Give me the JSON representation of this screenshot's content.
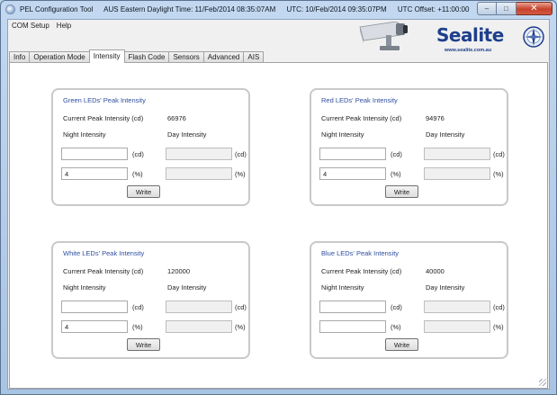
{
  "window": {
    "title_segments": [
      "PEL Configuration Tool",
      "AUS Eastern Daylight Time: 11/Feb/2014 08:35:07AM",
      "UTC: 10/Feb/2014 09:35:07PM",
      "UTC Offset: +11:00:00"
    ],
    "min_glyph": "–",
    "max_glyph": "□",
    "close_glyph": "✕"
  },
  "menu": {
    "items": [
      "COM Setup",
      "Help"
    ]
  },
  "logo": {
    "word": "Sealite",
    "url": "www.sealite.com.au"
  },
  "tabs": [
    "Info",
    "Operation Mode",
    "Intensity",
    "Flash Code",
    "Sensors",
    "Advanced",
    "AIS"
  ],
  "active_tab": "Intensity",
  "labels": {
    "current_peak": "Current Peak Intensity (cd)",
    "night": "Night Intensity",
    "day": "Day Intensity",
    "unit_cd": "(cd)",
    "unit_pct": "(%)",
    "write": "Write"
  },
  "groups": [
    {
      "title": "Green LEDs' Peak Intensity",
      "current_peak": "66976",
      "night_cd": "",
      "night_pct": "4"
    },
    {
      "title": "Red LEDs' Peak Intensity",
      "current_peak": "94976",
      "night_cd": "",
      "night_pct": "4"
    },
    {
      "title": "White LEDs' Peak Intensity",
      "current_peak": "120000",
      "night_cd": "",
      "night_pct": "4"
    },
    {
      "title": "Blue LEDs' Peak Intensity",
      "current_peak": "40000",
      "night_cd": "",
      "night_pct": ""
    }
  ],
  "colors": {
    "group_title": "#2f4f9f",
    "brand": "#1d3f8c"
  }
}
